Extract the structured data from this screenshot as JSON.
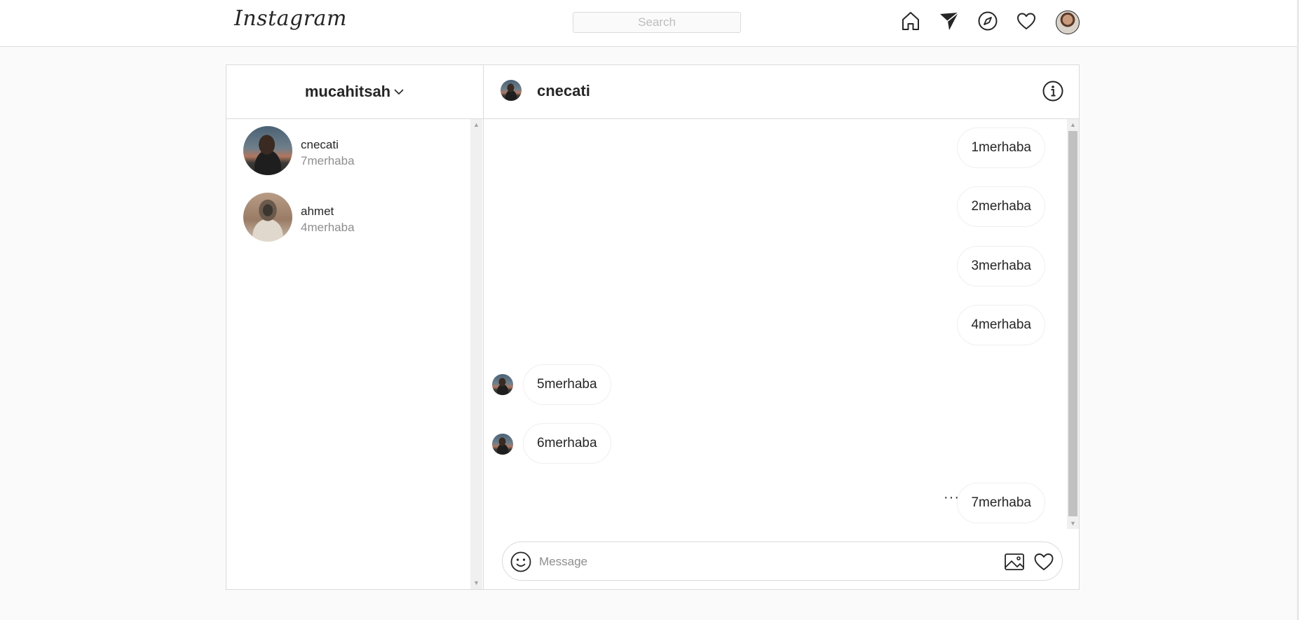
{
  "nav": {
    "logo": "Instagram",
    "search_placeholder": "Search",
    "icons": [
      "home-icon",
      "direct-send-icon",
      "explore-compass-icon",
      "activity-heart-icon",
      "profile-avatar"
    ]
  },
  "inbox": {
    "username": "mucahitsah",
    "conversations": [
      {
        "name": "cnecati",
        "last_message": "7merhaba"
      },
      {
        "name": "ahmet",
        "last_message": "4merhaba"
      }
    ]
  },
  "chat": {
    "title": "cnecati",
    "messages": [
      {
        "text": "1merhaba",
        "direction": "sent"
      },
      {
        "text": "2merhaba",
        "direction": "sent"
      },
      {
        "text": "3merhaba",
        "direction": "sent"
      },
      {
        "text": "4merhaba",
        "direction": "sent"
      },
      {
        "text": "5merhaba",
        "direction": "received"
      },
      {
        "text": "6merhaba",
        "direction": "received"
      },
      {
        "text": "7merhaba",
        "direction": "sent"
      }
    ],
    "more_options": "···",
    "composer": {
      "placeholder": "Message"
    }
  },
  "colors": {
    "background": "#fafafa",
    "border": "#dbdbdb",
    "text": "#262626",
    "secondary_text": "#8e8e8e"
  }
}
